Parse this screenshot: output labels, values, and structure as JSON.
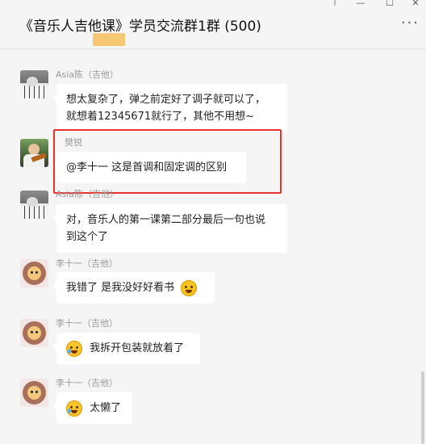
{
  "window": {
    "title": "《音乐人吉他课》学员交流群1群 (500)",
    "controls": {
      "pin": "⊤",
      "minimize": "—",
      "maximize": "☐",
      "close": "✕"
    },
    "more_icon": "···"
  },
  "messages": [
    {
      "sender": "Asia陈（吉他）",
      "avatar": "piano-avatar",
      "lines": [
        "想太复杂了，弹之前定好了调子就可以了，",
        "就想着12345671就行了，其他不用想~"
      ]
    },
    {
      "sender": "樊锐",
      "avatar": "guitar-avatar",
      "lines": [
        "@李十一 这是首调和固定调的区别"
      ]
    },
    {
      "sender": "Asia陈（吉他）",
      "avatar": "piano-avatar",
      "lines": [
        "对，音乐人的第一课第二部分最后一句也说",
        "到这个了"
      ]
    },
    {
      "sender": "李十一（吉他）",
      "avatar": "lion-avatar",
      "text": "我错了 是我没好好看书",
      "emoji": "laugh-emoji"
    },
    {
      "sender": "李十一（吉他）",
      "avatar": "lion-avatar",
      "text": "我拆开包装就放着了",
      "emoji": "cry-emoji"
    },
    {
      "sender": "李十一（吉他）",
      "avatar": "lion-avatar",
      "text": "太懒了",
      "emoji": "cry-emoji"
    }
  ],
  "colors": {
    "highlight": "#e5322d",
    "background": "#f5f5f5",
    "bubble": "#ffffff"
  }
}
